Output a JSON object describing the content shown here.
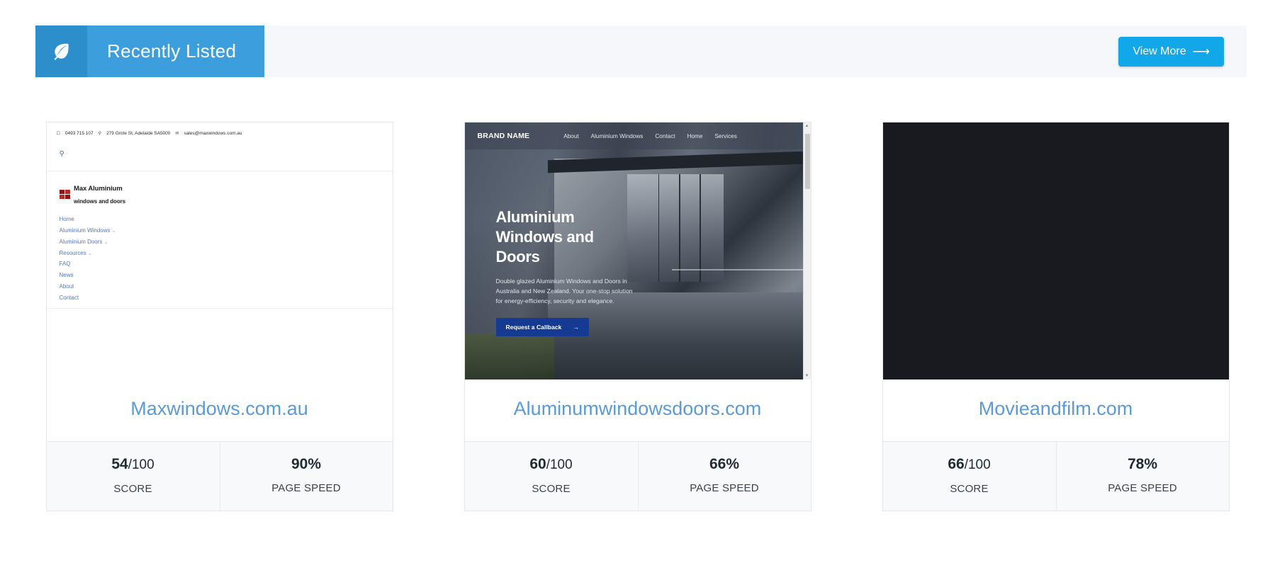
{
  "header": {
    "icon": "leaf-icon",
    "title": "Recently Listed",
    "view_more_label": "View More",
    "view_more_arrow": "⟶",
    "accent_blue": "#3d9ede",
    "icon_box_blue": "#2c8fcc",
    "button_blue": "#11a7e8",
    "bar_background": "#f5f7fa"
  },
  "cards": [
    {
      "domain": "Maxwindows.com.au",
      "score_value": "54",
      "score_suffix": "/100",
      "score_label": "SCORE",
      "speed_value": "90%",
      "speed_label": "PAGE SPEED",
      "thumbnail": {
        "kind": "website-screenshot-light",
        "topbar": {
          "phone_icon": "phone-icon",
          "phone": "0493 715 107",
          "location_icon": "location-pin-icon",
          "address": "279 Grote St, Adelaide SA5000",
          "mail_icon": "envelope-icon",
          "email": "sales@maxwindows.com.au"
        },
        "search_icon": "search-icon",
        "logo": {
          "line1": "Max Aluminium",
          "line2": "windows and doors",
          "mark_color": "#8f1515"
        },
        "nav": [
          {
            "label": "Home",
            "caret": ""
          },
          {
            "label": "Aluminium Windows",
            "caret": "⌄"
          },
          {
            "label": "Aluminium Doors",
            "caret": "⌄"
          },
          {
            "label": "Resources",
            "caret": "⌄"
          },
          {
            "label": "FAQ",
            "caret": ""
          },
          {
            "label": "News",
            "caret": ""
          },
          {
            "label": "About",
            "caret": ""
          },
          {
            "label": "Contact",
            "caret": ""
          }
        ],
        "nav_link_color": "#5878b8"
      }
    },
    {
      "domain": "Aluminumwindowsdoors.com",
      "score_value": "60",
      "score_suffix": "/100",
      "score_label": "SCORE",
      "speed_value": "66%",
      "speed_label": "PAGE SPEED",
      "thumbnail": {
        "kind": "website-screenshot-hero",
        "brand": "BRAND NAME",
        "nav": [
          "About",
          "Aluminium Windows",
          "Contact",
          "Home",
          "Services"
        ],
        "heading": "Aluminium Windows and Doors",
        "paragraph": "Double glazed Aluminium Windows and Doors in Australia and New Zealand. Your one-stop solution for energy-efficiency, security and elegance.",
        "cta_label": "Request a Callback",
        "cta_arrow": "→",
        "cta_color": "#143a91",
        "has_scrollbar": true
      }
    },
    {
      "domain": "Movieandfilm.com",
      "score_value": "66",
      "score_suffix": "/100",
      "score_label": "SCORE",
      "speed_value": "78%",
      "speed_label": "PAGE SPEED",
      "thumbnail": {
        "kind": "blank-dark",
        "color": "#191a1f"
      }
    }
  ]
}
